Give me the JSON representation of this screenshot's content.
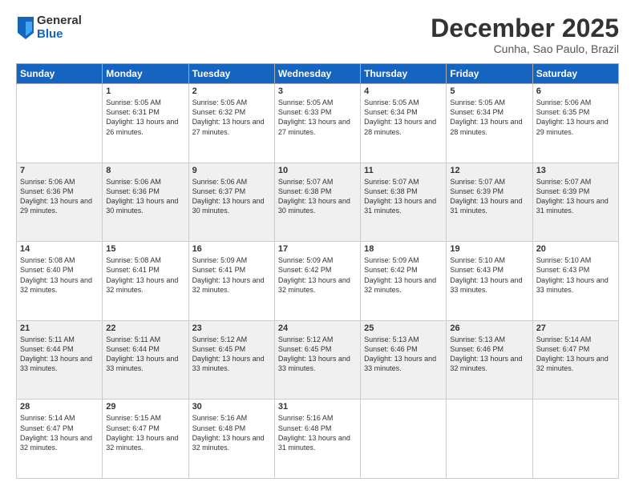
{
  "logo": {
    "general": "General",
    "blue": "Blue"
  },
  "title": "December 2025",
  "subtitle": "Cunha, Sao Paulo, Brazil",
  "days": [
    "Sunday",
    "Monday",
    "Tuesday",
    "Wednesday",
    "Thursday",
    "Friday",
    "Saturday"
  ],
  "weeks": [
    [
      {
        "day": "",
        "sunrise": "",
        "sunset": "",
        "daylight": ""
      },
      {
        "day": "1",
        "sunrise": "Sunrise: 5:05 AM",
        "sunset": "Sunset: 6:31 PM",
        "daylight": "Daylight: 13 hours and 26 minutes."
      },
      {
        "day": "2",
        "sunrise": "Sunrise: 5:05 AM",
        "sunset": "Sunset: 6:32 PM",
        "daylight": "Daylight: 13 hours and 27 minutes."
      },
      {
        "day": "3",
        "sunrise": "Sunrise: 5:05 AM",
        "sunset": "Sunset: 6:33 PM",
        "daylight": "Daylight: 13 hours and 27 minutes."
      },
      {
        "day": "4",
        "sunrise": "Sunrise: 5:05 AM",
        "sunset": "Sunset: 6:34 PM",
        "daylight": "Daylight: 13 hours and 28 minutes."
      },
      {
        "day": "5",
        "sunrise": "Sunrise: 5:05 AM",
        "sunset": "Sunset: 6:34 PM",
        "daylight": "Daylight: 13 hours and 28 minutes."
      },
      {
        "day": "6",
        "sunrise": "Sunrise: 5:06 AM",
        "sunset": "Sunset: 6:35 PM",
        "daylight": "Daylight: 13 hours and 29 minutes."
      }
    ],
    [
      {
        "day": "7",
        "sunrise": "Sunrise: 5:06 AM",
        "sunset": "Sunset: 6:36 PM",
        "daylight": "Daylight: 13 hours and 29 minutes."
      },
      {
        "day": "8",
        "sunrise": "Sunrise: 5:06 AM",
        "sunset": "Sunset: 6:36 PM",
        "daylight": "Daylight: 13 hours and 30 minutes."
      },
      {
        "day": "9",
        "sunrise": "Sunrise: 5:06 AM",
        "sunset": "Sunset: 6:37 PM",
        "daylight": "Daylight: 13 hours and 30 minutes."
      },
      {
        "day": "10",
        "sunrise": "Sunrise: 5:07 AM",
        "sunset": "Sunset: 6:38 PM",
        "daylight": "Daylight: 13 hours and 30 minutes."
      },
      {
        "day": "11",
        "sunrise": "Sunrise: 5:07 AM",
        "sunset": "Sunset: 6:38 PM",
        "daylight": "Daylight: 13 hours and 31 minutes."
      },
      {
        "day": "12",
        "sunrise": "Sunrise: 5:07 AM",
        "sunset": "Sunset: 6:39 PM",
        "daylight": "Daylight: 13 hours and 31 minutes."
      },
      {
        "day": "13",
        "sunrise": "Sunrise: 5:07 AM",
        "sunset": "Sunset: 6:39 PM",
        "daylight": "Daylight: 13 hours and 31 minutes."
      }
    ],
    [
      {
        "day": "14",
        "sunrise": "Sunrise: 5:08 AM",
        "sunset": "Sunset: 6:40 PM",
        "daylight": "Daylight: 13 hours and 32 minutes."
      },
      {
        "day": "15",
        "sunrise": "Sunrise: 5:08 AM",
        "sunset": "Sunset: 6:41 PM",
        "daylight": "Daylight: 13 hours and 32 minutes."
      },
      {
        "day": "16",
        "sunrise": "Sunrise: 5:09 AM",
        "sunset": "Sunset: 6:41 PM",
        "daylight": "Daylight: 13 hours and 32 minutes."
      },
      {
        "day": "17",
        "sunrise": "Sunrise: 5:09 AM",
        "sunset": "Sunset: 6:42 PM",
        "daylight": "Daylight: 13 hours and 32 minutes."
      },
      {
        "day": "18",
        "sunrise": "Sunrise: 5:09 AM",
        "sunset": "Sunset: 6:42 PM",
        "daylight": "Daylight: 13 hours and 32 minutes."
      },
      {
        "day": "19",
        "sunrise": "Sunrise: 5:10 AM",
        "sunset": "Sunset: 6:43 PM",
        "daylight": "Daylight: 13 hours and 33 minutes."
      },
      {
        "day": "20",
        "sunrise": "Sunrise: 5:10 AM",
        "sunset": "Sunset: 6:43 PM",
        "daylight": "Daylight: 13 hours and 33 minutes."
      }
    ],
    [
      {
        "day": "21",
        "sunrise": "Sunrise: 5:11 AM",
        "sunset": "Sunset: 6:44 PM",
        "daylight": "Daylight: 13 hours and 33 minutes."
      },
      {
        "day": "22",
        "sunrise": "Sunrise: 5:11 AM",
        "sunset": "Sunset: 6:44 PM",
        "daylight": "Daylight: 13 hours and 33 minutes."
      },
      {
        "day": "23",
        "sunrise": "Sunrise: 5:12 AM",
        "sunset": "Sunset: 6:45 PM",
        "daylight": "Daylight: 13 hours and 33 minutes."
      },
      {
        "day": "24",
        "sunrise": "Sunrise: 5:12 AM",
        "sunset": "Sunset: 6:45 PM",
        "daylight": "Daylight: 13 hours and 33 minutes."
      },
      {
        "day": "25",
        "sunrise": "Sunrise: 5:13 AM",
        "sunset": "Sunset: 6:46 PM",
        "daylight": "Daylight: 13 hours and 33 minutes."
      },
      {
        "day": "26",
        "sunrise": "Sunrise: 5:13 AM",
        "sunset": "Sunset: 6:46 PM",
        "daylight": "Daylight: 13 hours and 32 minutes."
      },
      {
        "day": "27",
        "sunrise": "Sunrise: 5:14 AM",
        "sunset": "Sunset: 6:47 PM",
        "daylight": "Daylight: 13 hours and 32 minutes."
      }
    ],
    [
      {
        "day": "28",
        "sunrise": "Sunrise: 5:14 AM",
        "sunset": "Sunset: 6:47 PM",
        "daylight": "Daylight: 13 hours and 32 minutes."
      },
      {
        "day": "29",
        "sunrise": "Sunrise: 5:15 AM",
        "sunset": "Sunset: 6:47 PM",
        "daylight": "Daylight: 13 hours and 32 minutes."
      },
      {
        "day": "30",
        "sunrise": "Sunrise: 5:16 AM",
        "sunset": "Sunset: 6:48 PM",
        "daylight": "Daylight: 13 hours and 32 minutes."
      },
      {
        "day": "31",
        "sunrise": "Sunrise: 5:16 AM",
        "sunset": "Sunset: 6:48 PM",
        "daylight": "Daylight: 13 hours and 31 minutes."
      },
      {
        "day": "",
        "sunrise": "",
        "sunset": "",
        "daylight": ""
      },
      {
        "day": "",
        "sunrise": "",
        "sunset": "",
        "daylight": ""
      },
      {
        "day": "",
        "sunrise": "",
        "sunset": "",
        "daylight": ""
      }
    ]
  ]
}
